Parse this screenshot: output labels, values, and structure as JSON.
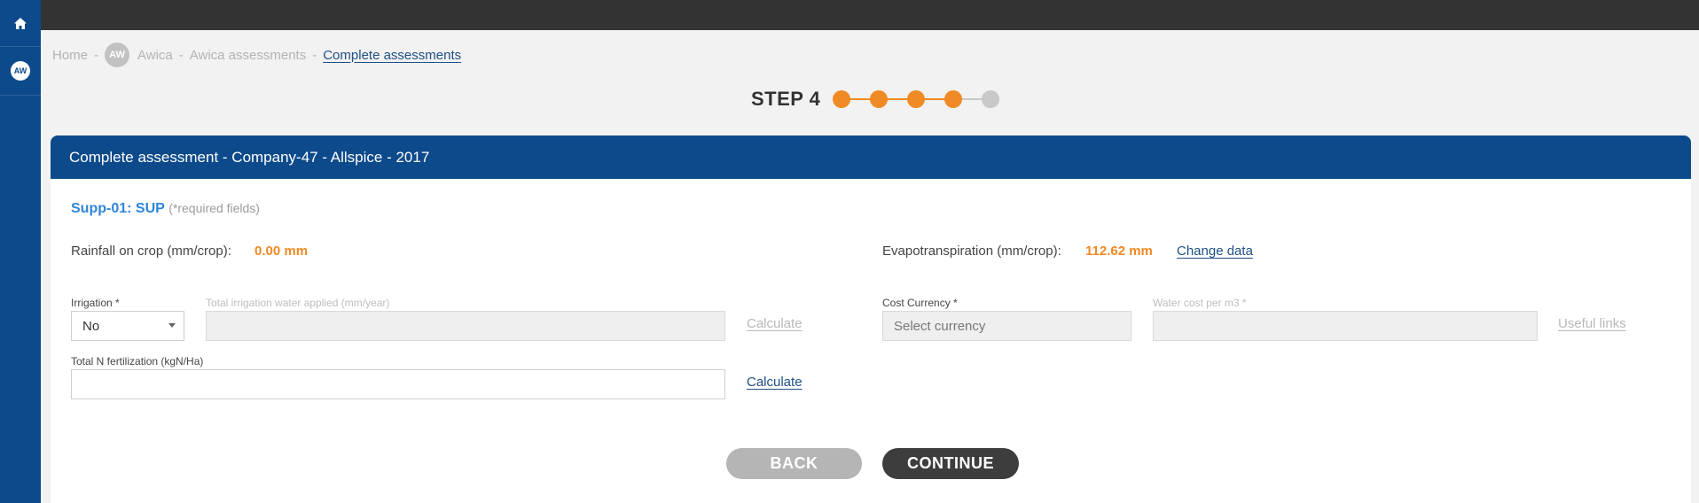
{
  "sidebar": {
    "home_icon": "home-icon",
    "badge": "AW"
  },
  "breadcrumb": {
    "home": "Home",
    "badge": "AW",
    "org": "Awica",
    "assessments": "Awica assessments",
    "current": "Complete assessments",
    "separator": "-"
  },
  "stepper": {
    "label": "STEP 4",
    "total_steps": 5,
    "completed_steps": 4,
    "active_color": "#f08a24",
    "inactive_color": "#c8c8c8"
  },
  "card": {
    "title": "Complete assessment - Company-47 - Allspice - 2017"
  },
  "section": {
    "code": "Supp-01: SUP",
    "note": "(*required fields)"
  },
  "metrics": {
    "rainfall_label": "Rainfall on crop (mm/crop):",
    "rainfall_value": "0.00 mm",
    "evapo_label": "Evapotranspiration (mm/crop):",
    "evapo_value": "112.62 mm",
    "change_data": "Change data"
  },
  "form": {
    "irrigation_label": "Irrigation *",
    "irrigation_value": "No",
    "water_applied_label": "Total irrigation water applied (mm/year)",
    "calculate_water": "Calculate",
    "currency_label": "Cost Currency *",
    "currency_placeholder": "Select currency",
    "water_cost_label": "Water cost per m3 *",
    "useful_links": "Useful links",
    "n_fert_label": "Total N fertilization (kgN/Ha)",
    "calculate_n": "Calculate"
  },
  "actions": {
    "back": "BACK",
    "continue": "CONTINUE"
  },
  "colors": {
    "brand_blue": "#0d4a8b",
    "accent_orange": "#f08a24",
    "link_blue": "#1e4f86"
  }
}
